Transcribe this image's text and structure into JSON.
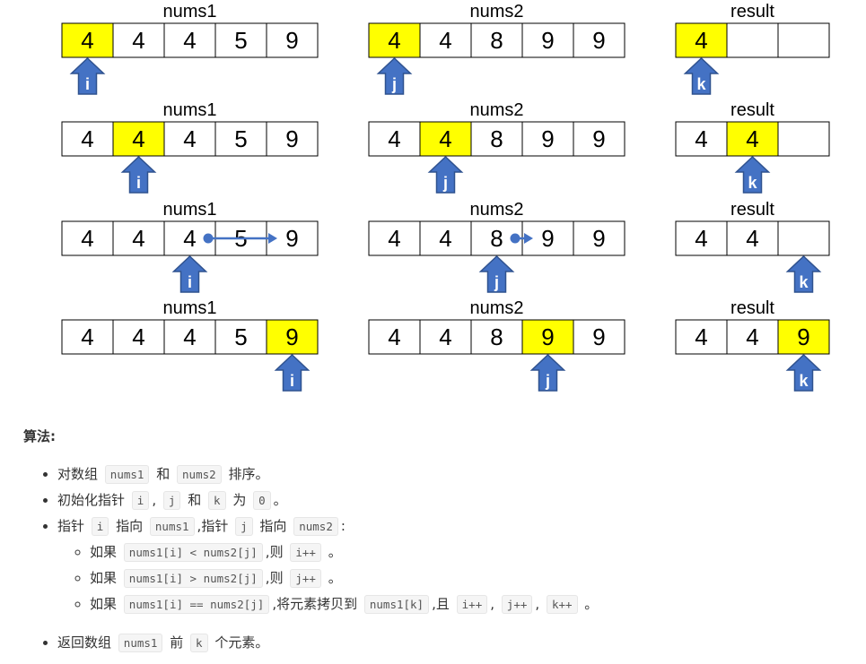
{
  "colors": {
    "highlight": "#ffff00",
    "arrow": "#4472c4",
    "border": "#000000"
  },
  "rows": [
    {
      "arrays": [
        {
          "label": "nums1",
          "cells": [
            "4",
            "4",
            "4",
            "5",
            "9"
          ],
          "highlight": 0,
          "pointer": "i",
          "pointer_cell": 0
        },
        {
          "label": "nums2",
          "cells": [
            "4",
            "4",
            "8",
            "9",
            "9"
          ],
          "highlight": 0,
          "pointer": "j",
          "pointer_cell": 0
        },
        {
          "label": "result",
          "cells": [
            "4",
            "",
            ""
          ],
          "highlight": 0,
          "pointer": "k",
          "pointer_cell": 0
        }
      ]
    },
    {
      "arrays": [
        {
          "label": "nums1",
          "cells": [
            "4",
            "4",
            "4",
            "5",
            "9"
          ],
          "highlight": 1,
          "pointer": "i",
          "pointer_cell": 1
        },
        {
          "label": "nums2",
          "cells": [
            "4",
            "4",
            "8",
            "9",
            "9"
          ],
          "highlight": 1,
          "pointer": "j",
          "pointer_cell": 1
        },
        {
          "label": "result",
          "cells": [
            "4",
            "4",
            ""
          ],
          "highlight": 1,
          "pointer": "k",
          "pointer_cell": 1
        }
      ]
    },
    {
      "arrays": [
        {
          "label": "nums1",
          "cells": [
            "4",
            "4",
            "4",
            "5",
            "9"
          ],
          "highlight": -1,
          "pointer": "i",
          "pointer_cell": 2,
          "move": [
            2,
            4
          ]
        },
        {
          "label": "nums2",
          "cells": [
            "4",
            "4",
            "8",
            "9",
            "9"
          ],
          "highlight": -1,
          "pointer": "j",
          "pointer_cell": 2,
          "move": [
            2,
            3
          ]
        },
        {
          "label": "result",
          "cells": [
            "4",
            "4",
            ""
          ],
          "highlight": -1,
          "pointer": "k",
          "pointer_cell": 2
        }
      ]
    },
    {
      "arrays": [
        {
          "label": "nums1",
          "cells": [
            "4",
            "4",
            "4",
            "5",
            "9"
          ],
          "highlight": 4,
          "pointer": "i",
          "pointer_cell": 4
        },
        {
          "label": "nums2",
          "cells": [
            "4",
            "4",
            "8",
            "9",
            "9"
          ],
          "highlight": 3,
          "pointer": "j",
          "pointer_cell": 3
        },
        {
          "label": "result",
          "cells": [
            "4",
            "4",
            "9"
          ],
          "highlight": 2,
          "pointer": "k",
          "pointer_cell": 2
        }
      ]
    }
  ],
  "algorithm": {
    "title": "算法:",
    "steps": {
      "s1": {
        "a": "对数组",
        "c1": "nums1",
        "b": "和",
        "c2": "nums2",
        "c": "排序。"
      },
      "s2": {
        "a": "初始化指针",
        "c1": "i",
        "b": ",",
        "c2": "j",
        "c": "和",
        "c3": "k",
        "d": "为",
        "c4": "0",
        "e": "。"
      },
      "s3": {
        "a": "指针",
        "c1": "i",
        "b": "指向",
        "c2": "nums1",
        "c": ",指针",
        "c3": "j",
        "d": "指向",
        "c4": "nums2",
        "e": ":"
      },
      "sub1": {
        "a": "如果",
        "c1": "nums1[i] < nums2[j]",
        "b": ",则",
        "c2": "i++",
        "c": "。"
      },
      "sub2": {
        "a": "如果",
        "c1": "nums1[i] > nums2[j]",
        "b": ",则",
        "c2": "j++",
        "c": "。"
      },
      "sub3": {
        "a": "如果",
        "c1": "nums1[i] == nums2[j]",
        "b": ",将元素拷贝到",
        "c2": "nums1[k]",
        "c": ",且",
        "c3": "i++",
        "d": ",",
        "c4": "j++",
        "e": ",",
        "c5": "k++",
        "f": "。"
      },
      "s4": {
        "a": "返回数组",
        "c1": "nums1",
        "b": "前",
        "c2": "k",
        "c": "个元素。"
      }
    }
  }
}
